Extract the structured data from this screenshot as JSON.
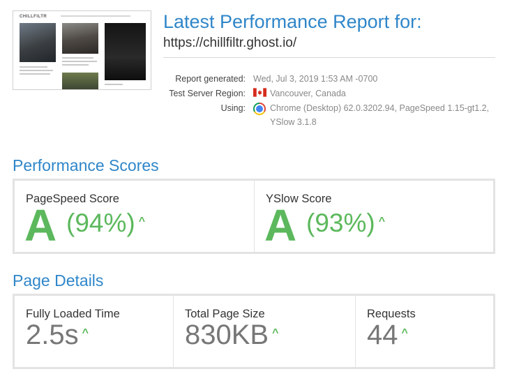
{
  "header": {
    "title": "Latest Performance Report for:",
    "url": "https://chillfiltr.ghost.io/"
  },
  "thumbnail": {
    "site_logo": "CHILLFILTR"
  },
  "report_meta": {
    "generated_label": "Report generated:",
    "generated_value": "Wed, Jul 3, 2019 1:53 AM -0700",
    "region_label": "Test Server Region:",
    "region_value": "Vancouver, Canada",
    "region_icon": "canada-flag-icon",
    "using_label": "Using:",
    "using_line1": "Chrome (Desktop) 62.0.3202.94, PageSpeed 1.15-gt1.2,",
    "using_line2": "YSlow 3.1.8",
    "using_icon": "chrome-icon"
  },
  "performance": {
    "section_title": "Performance Scores",
    "pagespeed": {
      "label": "PageSpeed Score",
      "grade": "A",
      "percent": "(94%)",
      "trend_icon": "caret-up-icon"
    },
    "yslow": {
      "label": "YSlow Score",
      "grade": "A",
      "percent": "(93%)",
      "trend_icon": "caret-up-icon"
    }
  },
  "details": {
    "section_title": "Page Details",
    "fully_loaded": {
      "label": "Fully Loaded Time",
      "value": "2.5s"
    },
    "page_size": {
      "label": "Total Page Size",
      "value": "830KB"
    },
    "requests": {
      "label": "Requests",
      "value": "44"
    }
  },
  "colors": {
    "accent": "#2f86c9",
    "good": "#5cb85c",
    "muted": "#777777",
    "border": "#e3e3e3"
  }
}
